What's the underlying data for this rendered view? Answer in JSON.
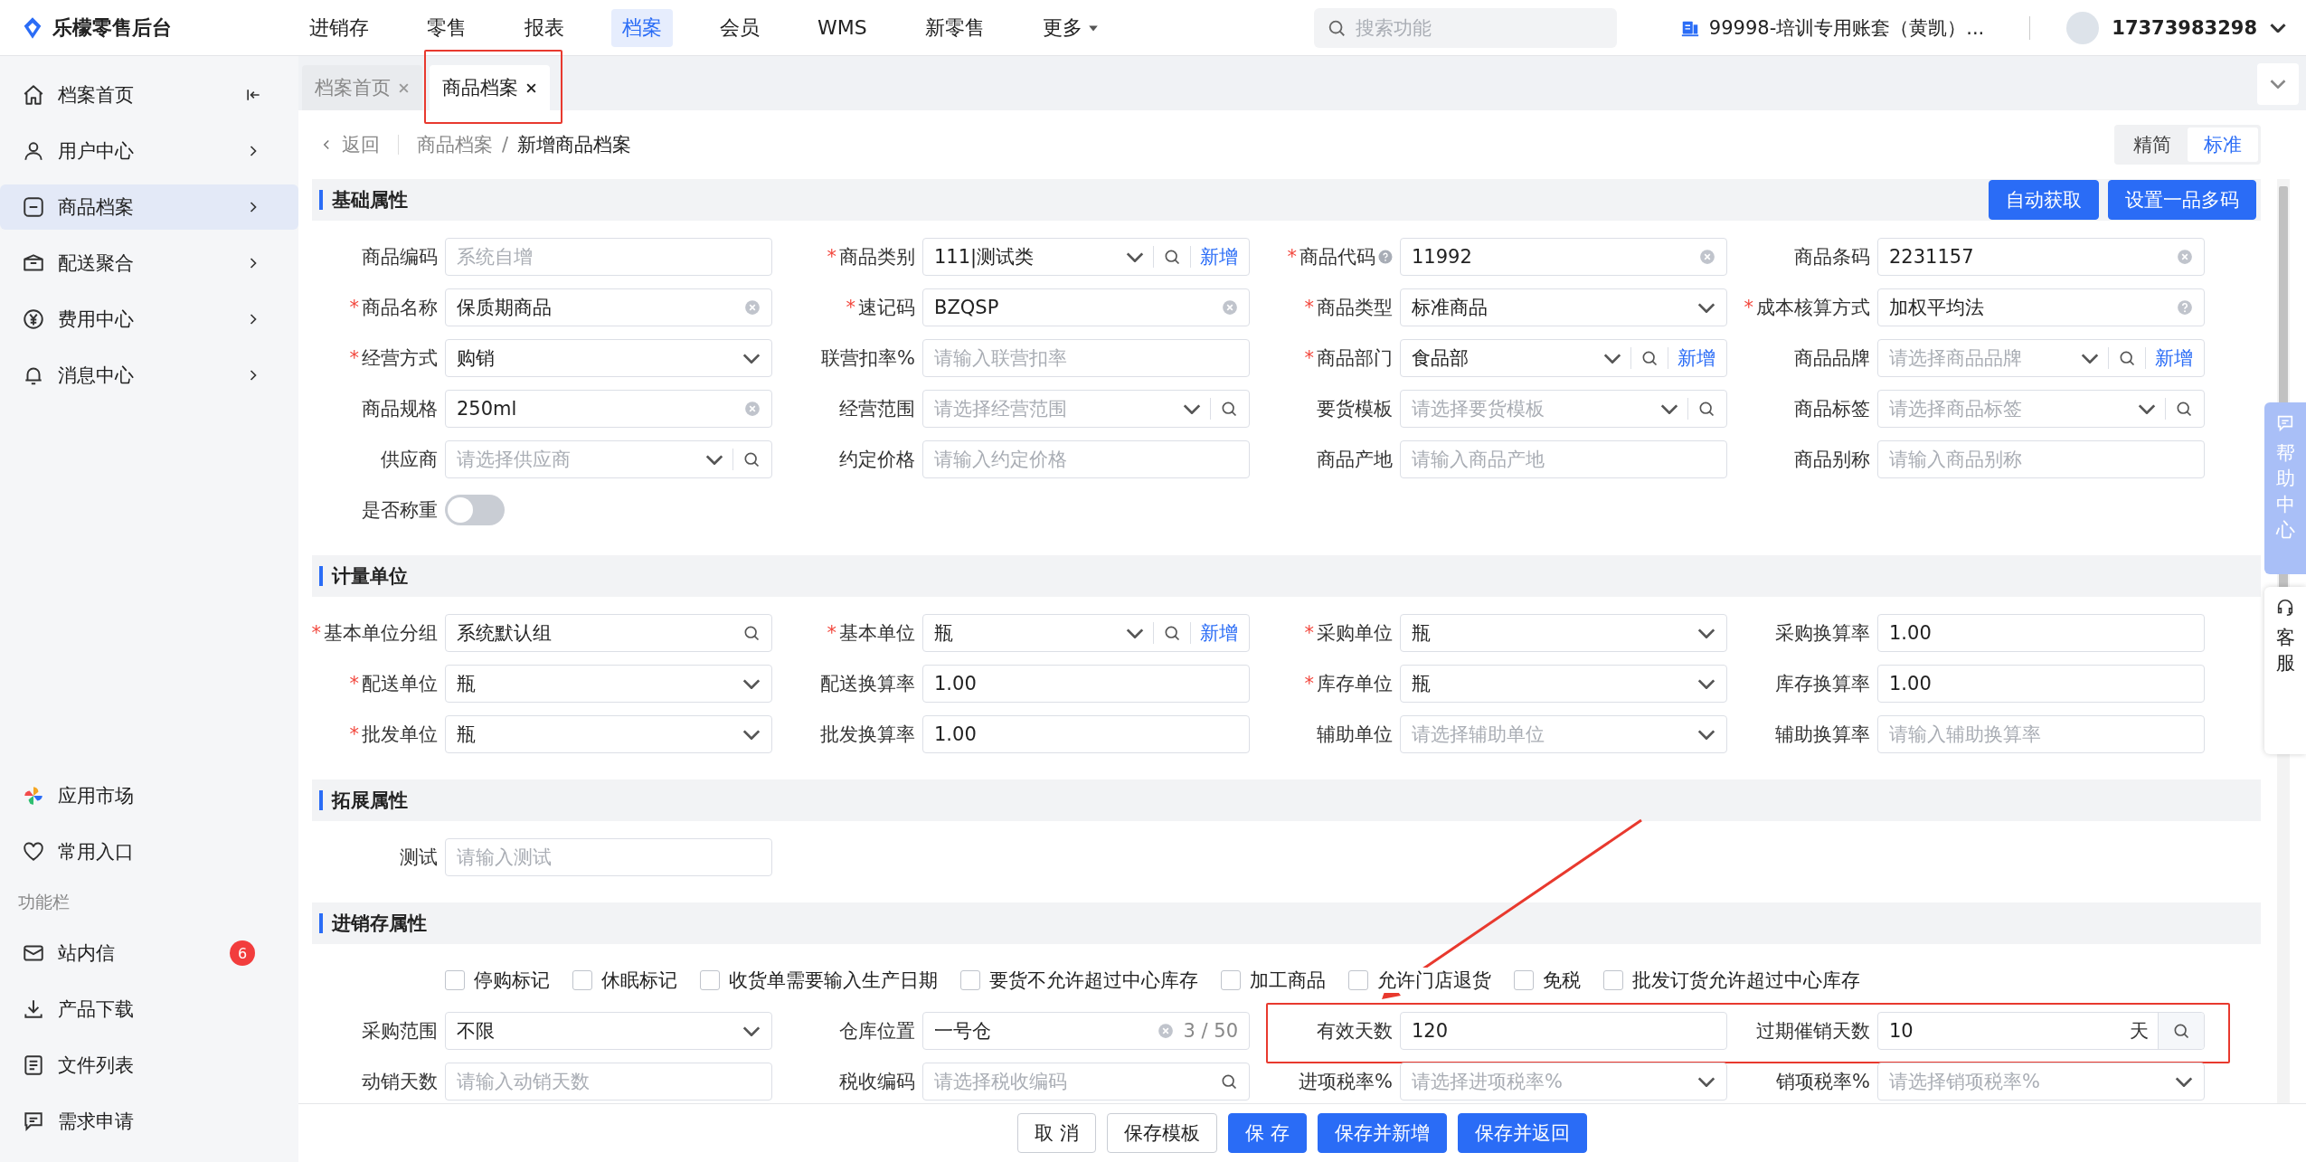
{
  "app": {
    "name": "乐檬零售后台"
  },
  "nav": [
    {
      "label": "进销存",
      "selected": false
    },
    {
      "label": "零售",
      "selected": false
    },
    {
      "label": "报表",
      "selected": false
    },
    {
      "label": "档案",
      "selected": true
    },
    {
      "label": "会员",
      "selected": false
    },
    {
      "label": "WMS",
      "selected": false
    },
    {
      "label": "新零售",
      "selected": false
    },
    {
      "label": "更多",
      "selected": false,
      "kind": "menu"
    }
  ],
  "search": {
    "placeholder": "搜索功能"
  },
  "account": "99998-培训专用账套（黄凯）...",
  "user": {
    "name": "17373983298"
  },
  "sidebar": {
    "items": [
      {
        "label": "档案首页",
        "selected": false,
        "kind": "collapse"
      },
      {
        "label": "用户中心",
        "selected": false,
        "kind": "expand"
      },
      {
        "label": "商品档案",
        "selected": true,
        "kind": "expand"
      },
      {
        "label": "配送聚合",
        "selected": false,
        "kind": "expand"
      },
      {
        "label": "费用中心",
        "selected": false,
        "kind": "expand"
      },
      {
        "label": "消息中心",
        "selected": false,
        "kind": "expand"
      }
    ],
    "shortcuts": [
      "应用市场",
      "常用入口"
    ],
    "function_bar": {
      "title": "功能栏",
      "items": [
        {
          "label": "站内信",
          "badge": "6"
        },
        {
          "label": "产品下载"
        },
        {
          "label": "文件列表"
        },
        {
          "label": "需求申请"
        }
      ]
    }
  },
  "tabs": [
    {
      "label": "档案首页",
      "selected": false,
      "highlighted": false
    },
    {
      "label": "商品档案",
      "selected": true,
      "highlighted": true
    }
  ],
  "breadcrumb": {
    "back": "返回",
    "path": [
      "商品档案",
      "新增商品档案"
    ],
    "separator": "/"
  },
  "view_modes": [
    {
      "label": "精简",
      "selected": false
    },
    {
      "label": "标准",
      "selected": true
    }
  ],
  "sections": [
    {
      "title": "基础属性",
      "buttons": [
        "自动获取",
        "设置一品多码"
      ],
      "rows": [
        [
          {
            "label": "商品编码",
            "kind": "input",
            "placeholder": "系统自增"
          },
          {
            "label": "商品类别",
            "required": "*",
            "kind": "select",
            "value": "111|测试类",
            "search": true,
            "add": "新增"
          },
          {
            "label": "商品代码",
            "required": "*",
            "label_help": true,
            "kind": "input",
            "value": "11992",
            "clear": true
          },
          {
            "label": "商品条码",
            "kind": "input",
            "value": "2231157",
            "clear": true
          }
        ],
        [
          {
            "label": "商品名称",
            "required": "*",
            "kind": "input",
            "value": "保质期商品",
            "clear": true
          },
          {
            "label": "速记码",
            "required": "*",
            "kind": "input",
            "value": "BZQSP",
            "clear": true
          },
          {
            "label": "商品类型",
            "required": "*",
            "kind": "select",
            "value": "标准商品"
          },
          {
            "label": "成本核算方式",
            "required": "*",
            "kind": "input",
            "value": "加权平均法",
            "help": true
          }
        ],
        [
          {
            "label": "经营方式",
            "required": "*",
            "kind": "select",
            "value": "购销"
          },
          {
            "label": "联营扣率%",
            "kind": "input",
            "placeholder": "请输入联营扣率"
          },
          {
            "label": "商品部门",
            "required": "*",
            "kind": "select",
            "value": "食品部",
            "search": true,
            "add": "新增"
          },
          {
            "label": "商品品牌",
            "kind": "select",
            "placeholder": "请选择商品品牌",
            "search": true,
            "add": "新增"
          }
        ],
        [
          {
            "label": "商品规格",
            "kind": "input",
            "value": "250ml",
            "clear": true
          },
          {
            "label": "经营范围",
            "kind": "select",
            "placeholder": "请选择经营范围",
            "search": true
          },
          {
            "label": "要货模板",
            "kind": "select",
            "placeholder": "请选择要货模板",
            "search": true
          },
          {
            "label": "商品标签",
            "kind": "select",
            "placeholder": "请选择商品标签",
            "search": true
          }
        ],
        [
          {
            "label": "供应商",
            "kind": "select",
            "placeholder": "请选择供应商",
            "search": true
          },
          {
            "label": "约定价格",
            "kind": "input",
            "placeholder": "请输入约定价格"
          },
          {
            "label": "商品产地",
            "kind": "input",
            "placeholder": "请输入商品产地"
          },
          {
            "label": "商品别称",
            "kind": "input",
            "placeholder": "请输入商品别称"
          }
        ],
        [
          {
            "label": "是否称重",
            "kind": "toggle",
            "on": false
          }
        ]
      ]
    },
    {
      "title": "计量单位",
      "rows": [
        [
          {
            "label": "基本单位分组",
            "required": "*",
            "kind": "input",
            "value": "系统默认组",
            "search": true
          },
          {
            "label": "基本单位",
            "required": "*",
            "kind": "select",
            "value": "瓶",
            "search": true,
            "add": "新增"
          },
          {
            "label": "采购单位",
            "required": "*",
            "kind": "select",
            "value": "瓶"
          },
          {
            "label": "采购换算率",
            "kind": "input",
            "value": "1.00"
          }
        ],
        [
          {
            "label": "配送单位",
            "required": "*",
            "kind": "select",
            "value": "瓶"
          },
          {
            "label": "配送换算率",
            "kind": "input",
            "value": "1.00"
          },
          {
            "label": "库存单位",
            "required": "*",
            "kind": "select",
            "value": "瓶"
          },
          {
            "label": "库存换算率",
            "kind": "input",
            "value": "1.00"
          }
        ],
        [
          {
            "label": "批发单位",
            "required": "*",
            "kind": "select",
            "value": "瓶"
          },
          {
            "label": "批发换算率",
            "kind": "input",
            "value": "1.00"
          },
          {
            "label": "辅助单位",
            "kind": "select",
            "placeholder": "请选择辅助单位"
          },
          {
            "label": "辅助换算率",
            "kind": "input",
            "placeholder": "请输入辅助换算率"
          }
        ]
      ]
    },
    {
      "title": "拓展属性",
      "rows": [
        [
          {
            "label": "测试",
            "kind": "input",
            "placeholder": "请输入测试"
          }
        ]
      ]
    },
    {
      "title": "进销存属性",
      "checkboxes": [
        {
          "label": "停购标记",
          "checked": false
        },
        {
          "label": "休眠标记",
          "checked": false
        },
        {
          "label": "收货单需要输入生产日期",
          "checked": false
        },
        {
          "label": "要货不允许超过中心库存",
          "checked": false
        },
        {
          "label": "加工商品",
          "checked": false
        },
        {
          "label": "允许门店退货",
          "checked": false
        },
        {
          "label": "免税",
          "checked": false
        },
        {
          "label": "批发订货允许超过中心库存",
          "checked": false
        }
      ],
      "rows": [
        [
          {
            "label": "采购范围",
            "kind": "select",
            "value": "不限"
          },
          {
            "label": "仓库位置",
            "kind": "input",
            "value": "一号仓",
            "clear": true,
            "counter": "3 / 50"
          },
          {
            "label": "有效天数",
            "kind": "input",
            "value": "120",
            "highlighted": true
          },
          {
            "label": "过期催销天数",
            "kind": "input",
            "value": "10",
            "suffix": "天",
            "search": true,
            "highlighted": true
          }
        ],
        [
          {
            "label": "动销天数",
            "kind": "input",
            "placeholder": "请输入动销天数"
          },
          {
            "label": "税收编码",
            "kind": "input",
            "placeholder": "请选择税收编码",
            "search": true
          },
          {
            "label": "进项税率%",
            "kind": "select",
            "placeholder": "请选择进项税率%"
          },
          {
            "label": "销项税率%",
            "kind": "select",
            "placeholder": "请选择销项税率%"
          }
        ]
      ]
    }
  ],
  "footer_buttons": [
    {
      "label": "取 消",
      "kind": "default"
    },
    {
      "label": "保存模板",
      "kind": "default"
    },
    {
      "label": "保 存",
      "kind": "primary"
    },
    {
      "label": "保存并新增",
      "kind": "primary"
    },
    {
      "label": "保存并返回",
      "kind": "primary"
    }
  ],
  "side_dock": [
    {
      "label": "帮助中心",
      "kind": "primary"
    },
    {
      "label": "客服",
      "kind": "default"
    }
  ]
}
